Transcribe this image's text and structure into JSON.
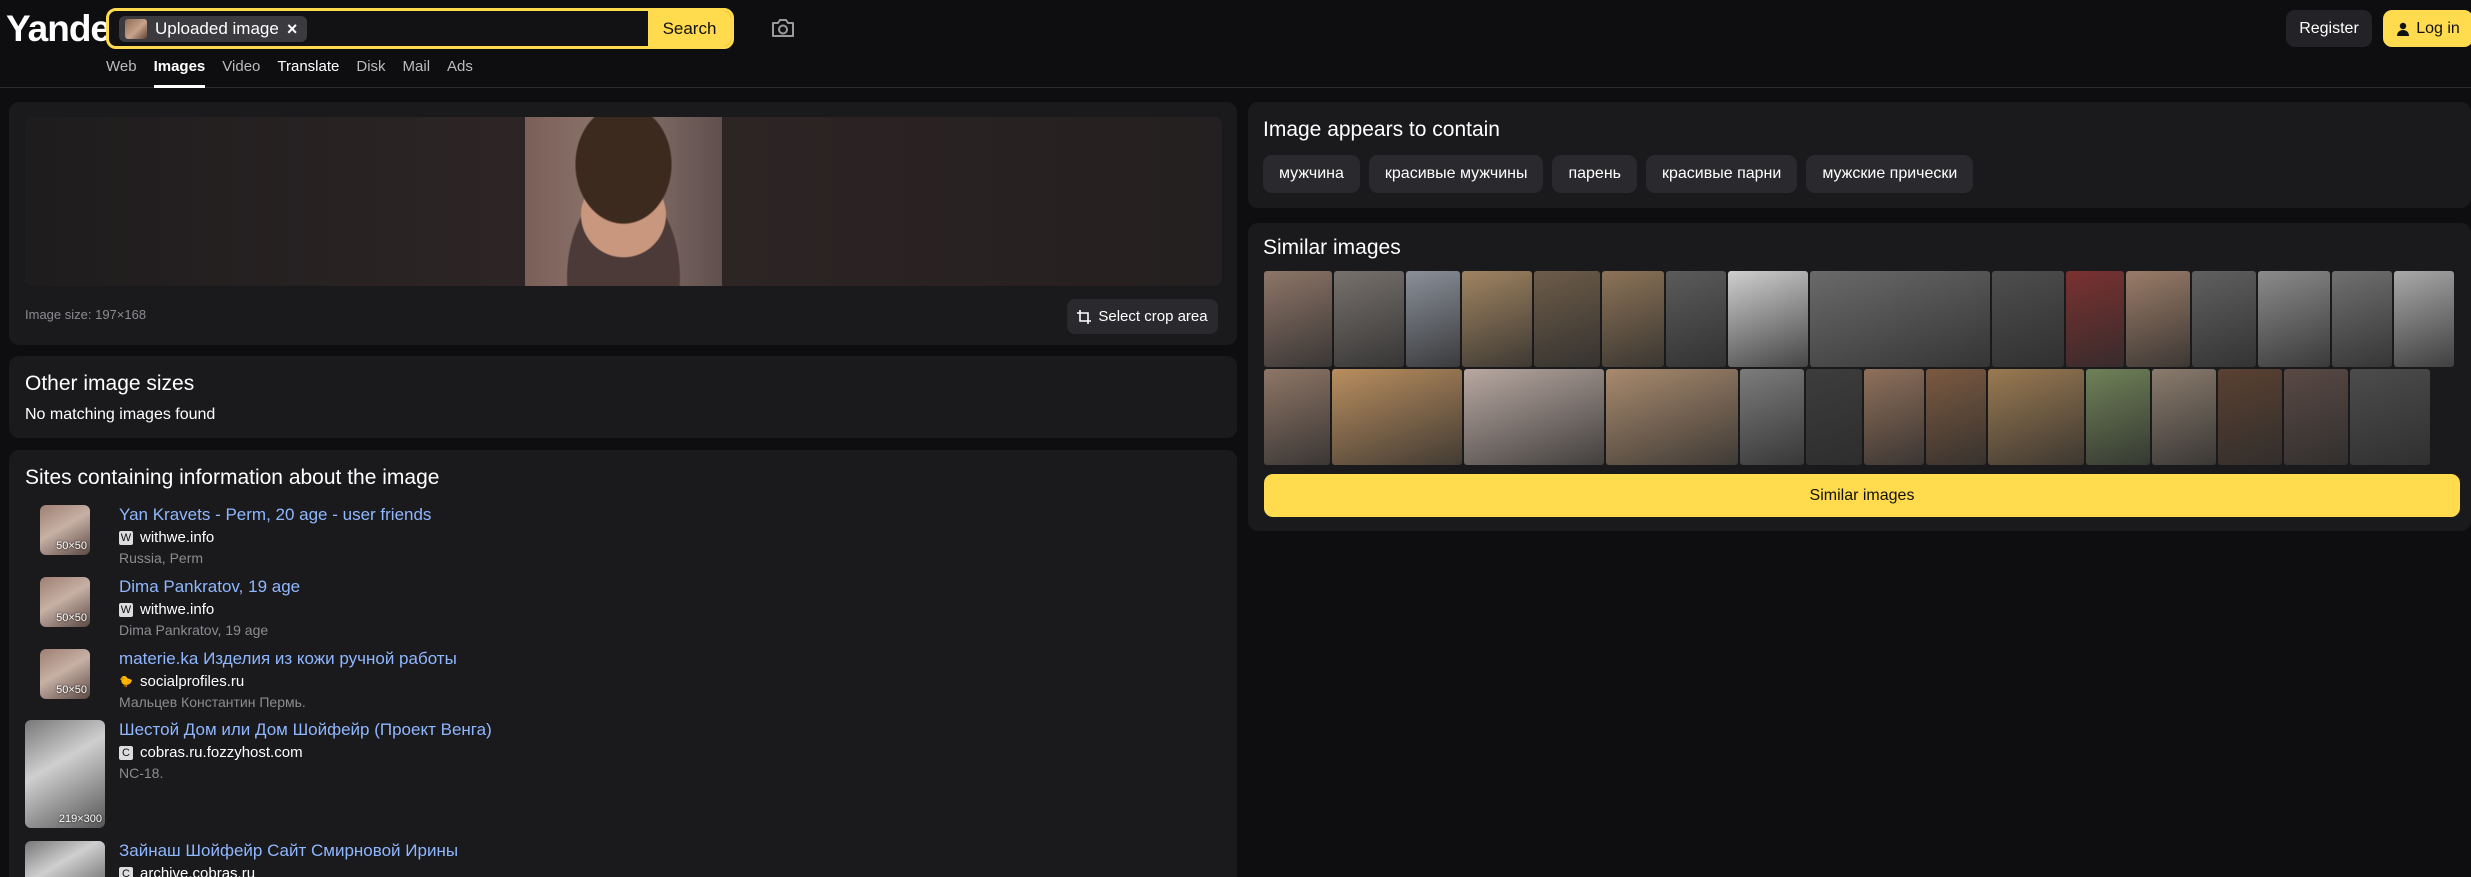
{
  "header": {
    "logo": "Yandex",
    "search_chip": "Uploaded image",
    "search_chip_close": "×",
    "search_placeholder": "",
    "search_button": "Search",
    "register": "Register",
    "login": "Log in",
    "tabs": [
      {
        "label": "Web"
      },
      {
        "label": "Images",
        "active": true
      },
      {
        "label": "Video"
      },
      {
        "label": "Translate"
      },
      {
        "label": "Disk"
      },
      {
        "label": "Mail"
      },
      {
        "label": "Ads"
      }
    ]
  },
  "preview": {
    "image_size": "Image size: 197×168",
    "crop_button": "Select crop area"
  },
  "other_sizes": {
    "title": "Other image sizes",
    "text": "No matching images found"
  },
  "sites": {
    "title": "Sites containing information about the image",
    "items": [
      {
        "title": "Yan Kravets - Perm, 20 age - user friends",
        "domain": "withwe.info",
        "favicon": "W",
        "desc": "Russia, Perm",
        "size": "50×50"
      },
      {
        "title": "Dima Pankratov, 19 age",
        "domain": "withwe.info",
        "favicon": "W",
        "desc": "Dima Pankratov, 19 age",
        "size": "50×50"
      },
      {
        "title": "materie.ka Изделия из кожи ручной работы",
        "domain": "socialprofiles.ru",
        "favicon": "🐤",
        "desc": "Мальцев Константин Пермь.",
        "size": "50×50"
      },
      {
        "title": "Шестой Дом или Дом Шойфейр (Проект Венга)",
        "domain": "cobras.ru.fozzyhost.com",
        "favicon": "C",
        "desc": "NC-18.",
        "size": "219×300"
      },
      {
        "title": "Зайнаш Шойфейр Сайт Смирновой Ирины",
        "domain": "archive.cobras.ru",
        "favicon": "C",
        "desc": "",
        "size": ""
      }
    ]
  },
  "contains": {
    "title": "Image appears to contain",
    "tags": [
      "мужчина",
      "красивые мужчины",
      "парень",
      "красивые парни",
      "мужские прически"
    ]
  },
  "similar": {
    "title": "Similar images",
    "button": "Similar images",
    "row1": [
      {
        "color": "#8d7568"
      },
      {
        "color": "#77716d"
      },
      {
        "color": "#8a8f99"
      },
      {
        "color": "#a08461"
      },
      {
        "color": "#6d5c49"
      },
      {
        "color": "#8c7357"
      },
      {
        "color": "#5b5b5b"
      },
      {
        "color": "#cfcfcf"
      },
      {
        "color": "#6a6a6a"
      },
      {
        "color": "#4e4e4e"
      },
      {
        "color": "#7b3131"
      },
      {
        "color": "#9a7c68"
      },
      {
        "color": "#606060"
      },
      {
        "color": "#8b8b8b"
      },
      {
        "color": "#707070"
      },
      {
        "color": "#a9a9a9"
      }
    ],
    "row2": [
      {
        "color": "#8e7667"
      },
      {
        "color": "#b98e5f"
      },
      {
        "color": "#b8a8a1"
      },
      {
        "color": "#a88a6e"
      },
      {
        "color": "#7c7c7c"
      },
      {
        "color": "#3d3d3d"
      },
      {
        "color": "#8f705b"
      },
      {
        "color": "#7b5a41"
      },
      {
        "color": "#9a7a52"
      },
      {
        "color": "#6f8158"
      },
      {
        "color": "#8a7b6d"
      },
      {
        "color": "#5a4132"
      },
      {
        "color": "#594944"
      },
      {
        "color": "#4c4c4c"
      }
    ]
  }
}
